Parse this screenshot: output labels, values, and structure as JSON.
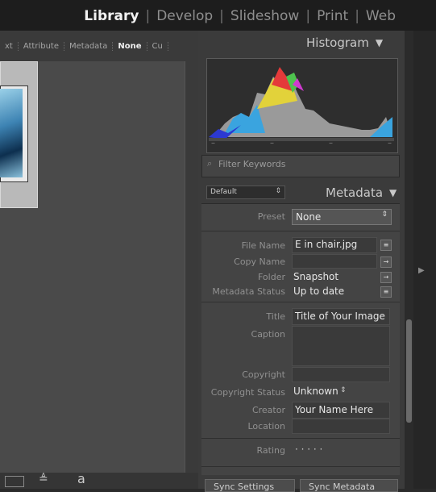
{
  "top_nav": {
    "modules": [
      "Library",
      "Develop",
      "Slideshow",
      "Print",
      "Web"
    ],
    "active": "Library"
  },
  "filter_bar": {
    "items": [
      "xt",
      "Attribute",
      "Metadata",
      "None",
      "Cu"
    ],
    "active": "None"
  },
  "histogram": {
    "title": "Histogram",
    "ticks": [
      "–",
      "–",
      "–",
      "–"
    ]
  },
  "keywords": {
    "placeholder": "Filter Keywords"
  },
  "metadata": {
    "title": "Metadata",
    "preset_select": "Default",
    "preset_label": "Preset",
    "preset_value": "None",
    "fields": {
      "file_name": {
        "label": "File Name",
        "value": "E in chair.jpg"
      },
      "copy_name": {
        "label": "Copy Name",
        "value": ""
      },
      "folder": {
        "label": "Folder",
        "value": "Snapshot"
      },
      "metadata_status": {
        "label": "Metadata Status",
        "value": "Up to date"
      },
      "title": {
        "label": "Title",
        "value": "Title of Your Image"
      },
      "caption": {
        "label": "Caption",
        "value": ""
      },
      "copyright": {
        "label": "Copyright",
        "value": ""
      },
      "copyright_status": {
        "label": "Copyright Status",
        "value": "Unknown"
      },
      "creator": {
        "label": "Creator",
        "value": "Your Name Here"
      },
      "location": {
        "label": "Location",
        "value": ""
      },
      "rating": {
        "label": "Rating",
        "value": "·  ·  ·  ·  ·"
      }
    }
  },
  "bottom": {
    "sync_settings": "Sync Settings",
    "sync_metadata": "Sync Metadata"
  },
  "colors": {
    "bg": "#2b2b2b",
    "panel": "#3b3b3b",
    "active_text": "#f2f2f2"
  }
}
